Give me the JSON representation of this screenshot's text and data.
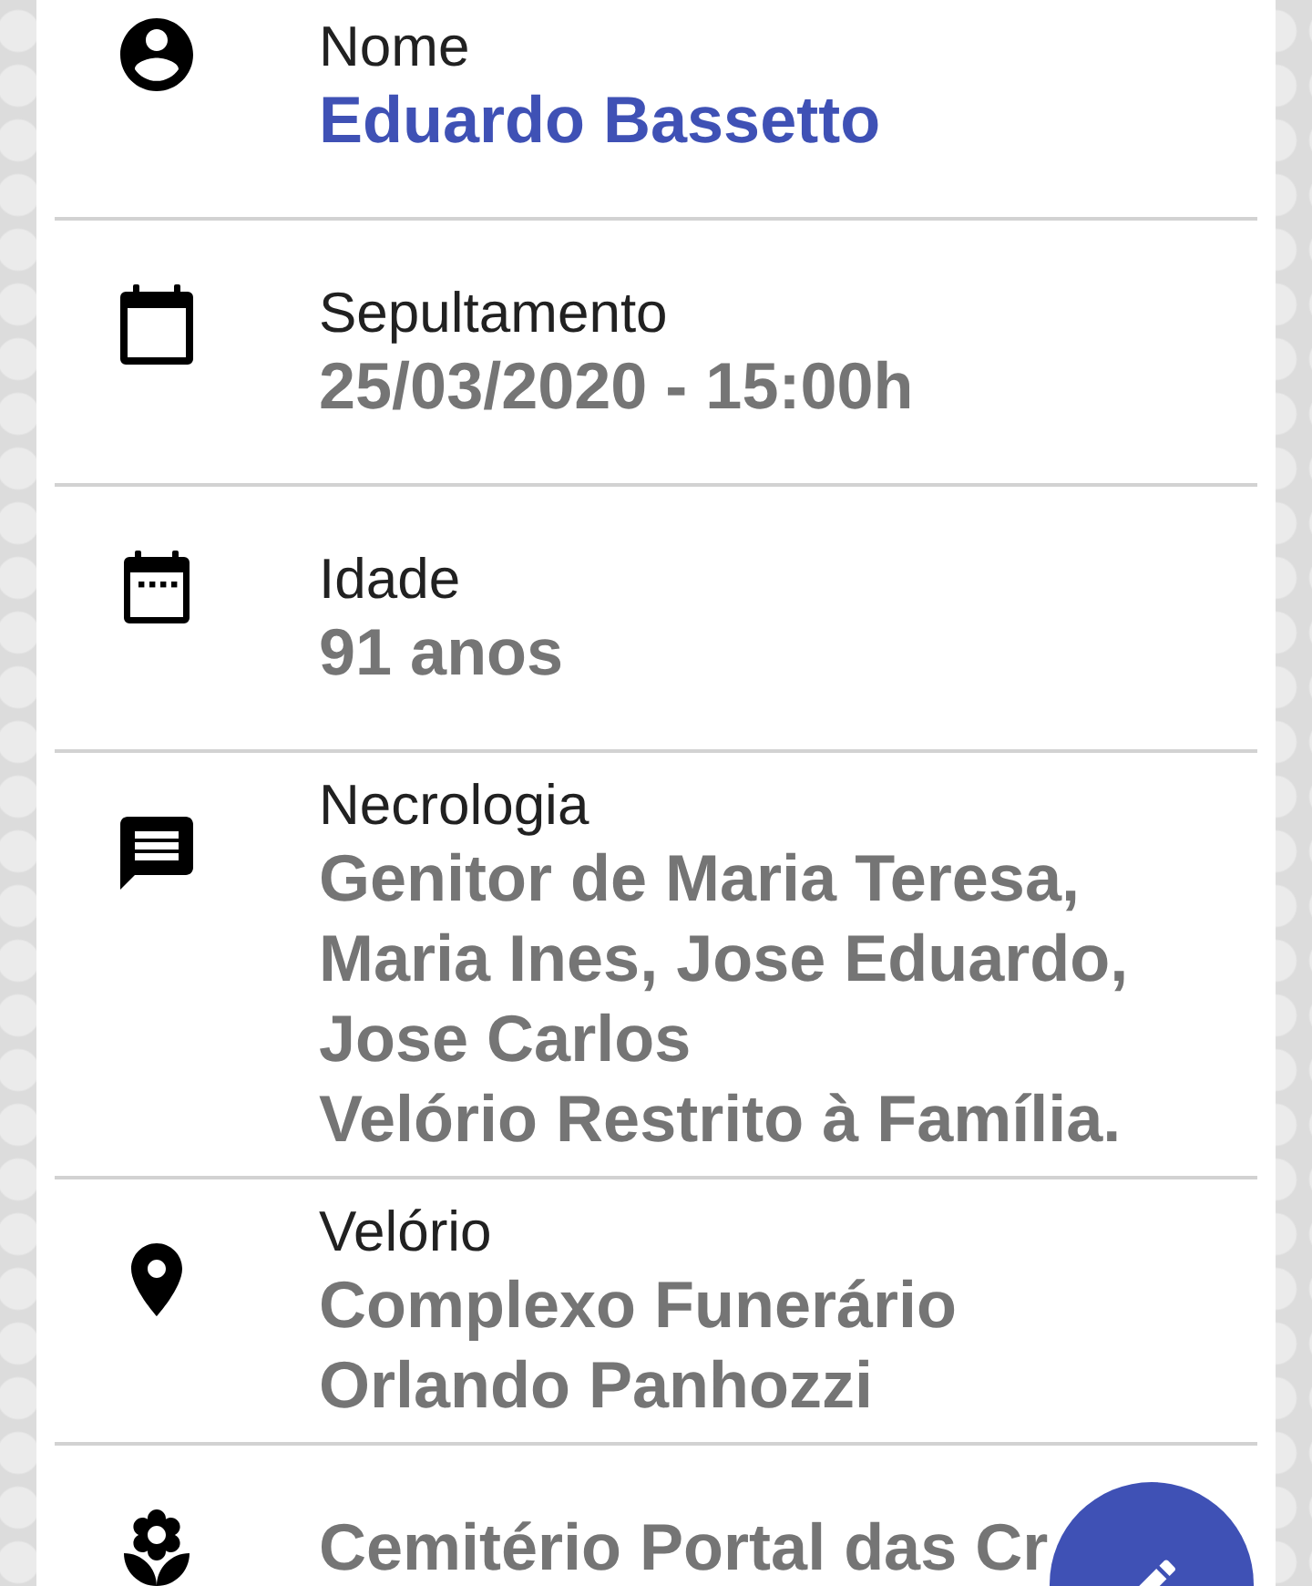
{
  "fields": [
    {
      "kind": "name",
      "label": "Nome",
      "value": "Eduardo Bassetto"
    },
    {
      "kind": "burial",
      "label": "Sepultamento",
      "value": "25/03/2020 - 15:00h"
    },
    {
      "kind": "age",
      "label": "Idade",
      "value": "91 anos"
    },
    {
      "kind": "obituary",
      "label": "Necrologia",
      "value": "Genitor de Maria Teresa,\nMaria Ines, Jose Eduardo,\nJose Carlos\nVelório Restrito à Família."
    },
    {
      "kind": "wake",
      "label": "Velório",
      "value": "Complexo Funerário\nOrlando Panhozzi"
    },
    {
      "kind": "cemetery",
      "value": "Cemitério Portal das Cr"
    }
  ]
}
